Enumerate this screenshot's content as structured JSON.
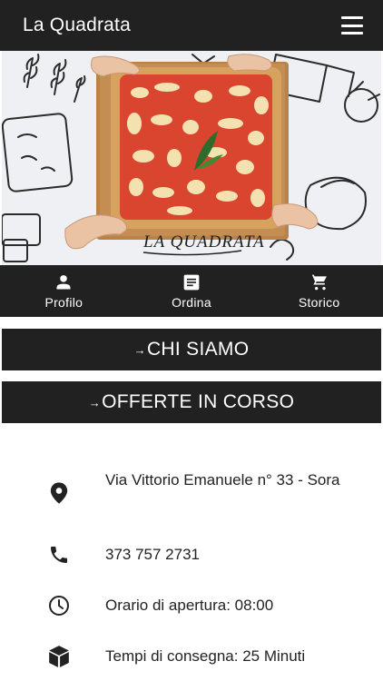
{
  "appbar": {
    "title": "La Quadrata",
    "menu_icon": "hamburger-menu-icon"
  },
  "hero": {
    "logo_text": "LA QUADRATA"
  },
  "tabs": [
    {
      "label": "Profilo",
      "icon": "person-icon"
    },
    {
      "label": "Ordina",
      "icon": "document-list-icon"
    },
    {
      "label": "Storico",
      "icon": "shopping-cart-icon"
    }
  ],
  "sections": [
    {
      "arrow": "→",
      "label": "CHI SIAMO"
    },
    {
      "arrow": "→",
      "label": "OFFERTE IN CORSO"
    }
  ],
  "info": {
    "address": "Via Vittorio Emanuele n° 33 - Sora",
    "phone": "373 757 2731",
    "hours": "Orario di apertura: 08:00",
    "delivery": "Tempi di consegna: 25 Minuti"
  },
  "colors": {
    "bar": "#212121",
    "background": "#ffffff",
    "text": "#222222"
  }
}
